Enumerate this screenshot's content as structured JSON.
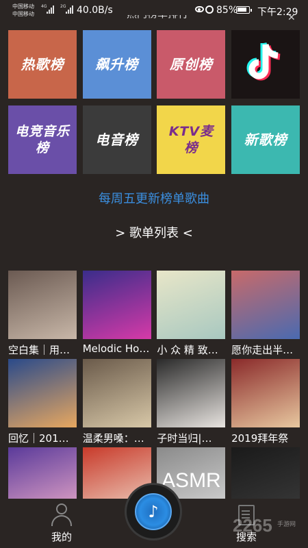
{
  "status_bar": {
    "carrier_1": "中国移动",
    "carrier_2": "中国移动",
    "net_1": "4G",
    "net_2": "2G",
    "speed": "40.0B/s",
    "battery": "85%",
    "time": "下午2:29"
  },
  "rank_tiles": [
    {
      "label": "热歌榜",
      "bg": "#c8664a",
      "color": "#ffffff"
    },
    {
      "label": "飙升榜",
      "bg": "#5b8fd6",
      "color": "#ffffff"
    },
    {
      "label": "原创榜",
      "bg": "#c95a6a",
      "color": "#ffffff"
    },
    {
      "label": "",
      "icon": "tiktok-logo",
      "bg": "#1a1414",
      "color": "#ffffff"
    },
    {
      "label": "电竞音乐榜",
      "bg": "#6a4fa8",
      "color": "#ffffff"
    },
    {
      "label": "电音榜",
      "bg": "#3b3b3b",
      "color": "#ffffff"
    },
    {
      "label": "KTV麦榜",
      "bg": "#f2d64a",
      "color": "#7a2d8c"
    },
    {
      "label": "新歌榜",
      "bg": "#3cb8b0",
      "color": "#ffffff"
    }
  ],
  "weekly_note": "每周五更新榜单歌曲",
  "list_heading": "> 歌单列表 <",
  "playlists": [
    {
      "label": "空白集｜用…",
      "c1": "#6b5a52",
      "c2": "#c8b7a8"
    },
    {
      "label": "Melodic Ho…",
      "c1": "#3a2d8a",
      "c2": "#d63aa8"
    },
    {
      "label": "小 众 精 致…",
      "c1": "#e8e6c8",
      "c2": "#a8c8c0"
    },
    {
      "label": "愿你走出半…",
      "c1": "#c86a6a",
      "c2": "#4a6ab0"
    },
    {
      "label": "回忆｜201…",
      "c1": "#2a4a8a",
      "c2": "#e8a860"
    },
    {
      "label": "温柔男嗓：…",
      "c1": "#6a5a4a",
      "c2": "#d8c8a8"
    },
    {
      "label": "子时当归|…",
      "c1": "#2a2a2a",
      "c2": "#e8e4e0"
    },
    {
      "label": "2019拜年祭",
      "c1": "#8a2a2a",
      "c2": "#e8c8a0"
    },
    {
      "label": "",
      "c1": "#5a3a9a",
      "c2": "#e8a8c8"
    },
    {
      "label": "",
      "c1": "#c83a2a",
      "c2": "#f0d8c8"
    },
    {
      "label": "",
      "text": "ASMR",
      "c1": "#8a8a8a",
      "c2": "#d8d8d8"
    },
    {
      "label": "",
      "c1": "#1a1a1a",
      "c2": "#3a3a3a"
    }
  ],
  "tabbar": {
    "mine_label": "我的",
    "search_label": "搜索"
  },
  "watermark": {
    "main": "2265",
    "sub": "手游网"
  }
}
